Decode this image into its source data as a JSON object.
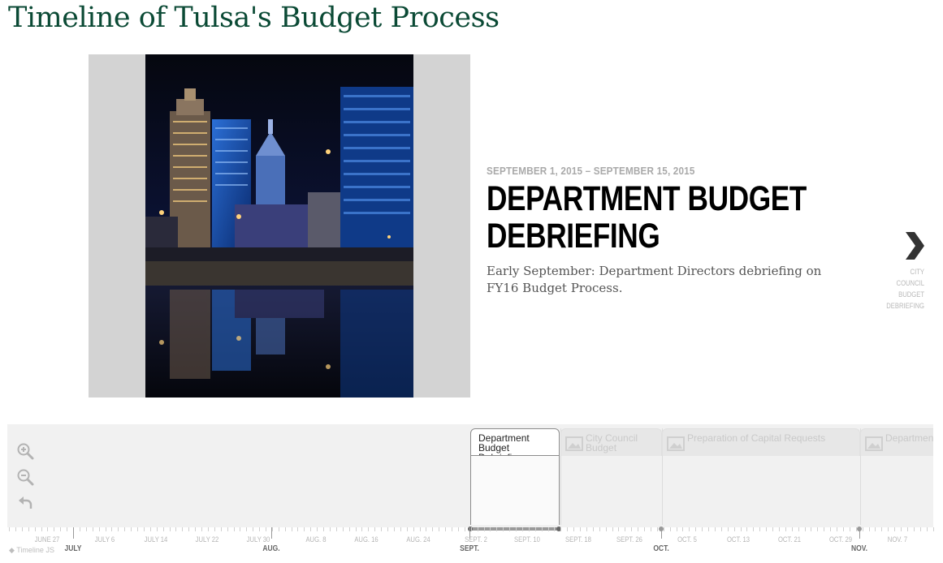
{
  "page": {
    "title": "Timeline of Tulsa's Budget Process"
  },
  "slide": {
    "date": "SEPTEMBER 1, 2015 – SEPTEMBER 15, 2015",
    "headline": "DEPARTMENT BUDGET DEBRIEFING",
    "text": "Early September: Department Directors debriefing on FY16 Budget Process."
  },
  "next": {
    "label": "CITY COUNCIL BUDGET DEBRIEFING",
    "icon": "chevron-right-icon"
  },
  "tools": {
    "zoom_in_icon": "zoom-in-icon",
    "zoom_out_icon": "zoom-out-icon",
    "back_icon": "undo-arrow-icon"
  },
  "markers": [
    {
      "label": "Department Budget Debriefing",
      "active": true
    },
    {
      "label": "City Council Budget",
      "active": false
    },
    {
      "label": "Preparation of Capital Requests",
      "active": false
    },
    {
      "label": "Departmen",
      "active": false
    }
  ],
  "axis": {
    "minor_labels": [
      "JUNE 27",
      "JULY 6",
      "JULY 14",
      "JULY 22",
      "JULY 30",
      "AUG. 8",
      "AUG. 16",
      "AUG. 24",
      "SEPT. 2",
      "SEPT. 10",
      "SEPT. 18",
      "SEPT. 26",
      "OCT. 5",
      "OCT. 13",
      "OCT. 21",
      "OCT. 29",
      "NOV. 7"
    ],
    "major_labels": [
      "JULY",
      "AUG.",
      "SEPT.",
      "OCT.",
      "NOV."
    ]
  },
  "credit": "Timeline JS",
  "colors": {
    "title": "#0b4a35",
    "headline": "#000000",
    "nav_band": "#f1f1f1"
  }
}
